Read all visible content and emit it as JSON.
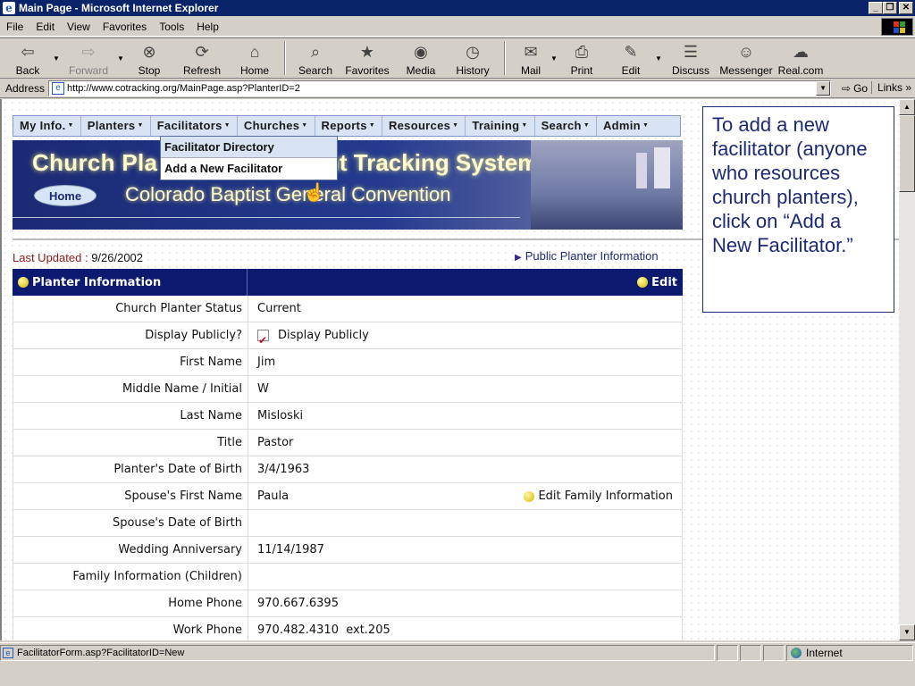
{
  "window": {
    "title": "Main Page - Microsoft Internet Explorer",
    "controls": [
      "_",
      "❐",
      "✕"
    ]
  },
  "menubar": {
    "items": [
      "File",
      "Edit",
      "View",
      "Favorites",
      "Tools",
      "Help"
    ]
  },
  "toolbar": {
    "items": [
      {
        "label": "Back",
        "icon": "back-arrow-icon"
      },
      {
        "label": "Forward",
        "icon": "forward-arrow-icon"
      },
      {
        "label": "Stop",
        "icon": "stop-icon"
      },
      {
        "label": "Refresh",
        "icon": "refresh-icon"
      },
      {
        "label": "Home",
        "icon": "home-icon"
      },
      {
        "label": "Search",
        "icon": "search-icon"
      },
      {
        "label": "Favorites",
        "icon": "favorites-icon"
      },
      {
        "label": "Media",
        "icon": "media-icon"
      },
      {
        "label": "History",
        "icon": "history-icon"
      },
      {
        "label": "Mail",
        "icon": "mail-icon"
      },
      {
        "label": "Print",
        "icon": "print-icon"
      },
      {
        "label": "Edit",
        "icon": "edit-icon"
      },
      {
        "label": "Discuss",
        "icon": "discuss-icon"
      },
      {
        "label": "Messenger",
        "icon": "messenger-icon"
      },
      {
        "label": "Real.com",
        "icon": "real-icon"
      }
    ]
  },
  "address": {
    "label": "Address",
    "url": "http://www.cotracking.org/MainPage.asp?PlanterID=2",
    "go": "Go",
    "links": "Links"
  },
  "nav": {
    "items": [
      "My Info.",
      "Planters",
      "Facilitators",
      "Churches",
      "Reports",
      "Resources",
      "Training",
      "Search",
      "Admin"
    ],
    "dropdown": [
      "Facilitator Directory",
      "Add a New Facilitator"
    ]
  },
  "banner": {
    "title_left": "Church Pla",
    "title_right": "nt Tracking System",
    "home": "Home",
    "subtitle": "Colorado Baptist General Convention"
  },
  "page": {
    "last_updated_label": "Last Updated :",
    "last_updated_value": "9/26/2002",
    "public_link": "Public Planter Information"
  },
  "planter": {
    "header": "Planter Information",
    "edit": "Edit",
    "rows": [
      {
        "label": "Church Planter Status",
        "value": "Current"
      },
      {
        "label": "Display Publicly?",
        "value": "Display Publicly"
      },
      {
        "label": "First Name",
        "value": "Jim"
      },
      {
        "label": "Middle Name / Initial",
        "value": "W"
      },
      {
        "label": "Last Name",
        "value": "Misloski"
      },
      {
        "label": "Title",
        "value": "Pastor"
      },
      {
        "label": "Planter's Date of Birth",
        "value": "3/4/1963"
      },
      {
        "label": "Spouse's First Name",
        "value": "Paula"
      },
      {
        "label": "Spouse's Date of Birth",
        "value": ""
      },
      {
        "label": "Wedding Anniversary",
        "value": "11/14/1987"
      },
      {
        "label": "Family Information (Children)",
        "value": ""
      },
      {
        "label": "Home Phone",
        "value": "970.667.6395"
      },
      {
        "label": "Work Phone",
        "value": "970.482.4310  ext.205"
      }
    ],
    "edit_family": "Edit Family Information"
  },
  "callout": {
    "text": "To add a new facilitator (anyone who resources church planters), click on “Add a New Facilitator.”"
  },
  "status": {
    "text": "FacilitatorForm.asp?FacilitatorID=New",
    "zone": "Internet"
  }
}
